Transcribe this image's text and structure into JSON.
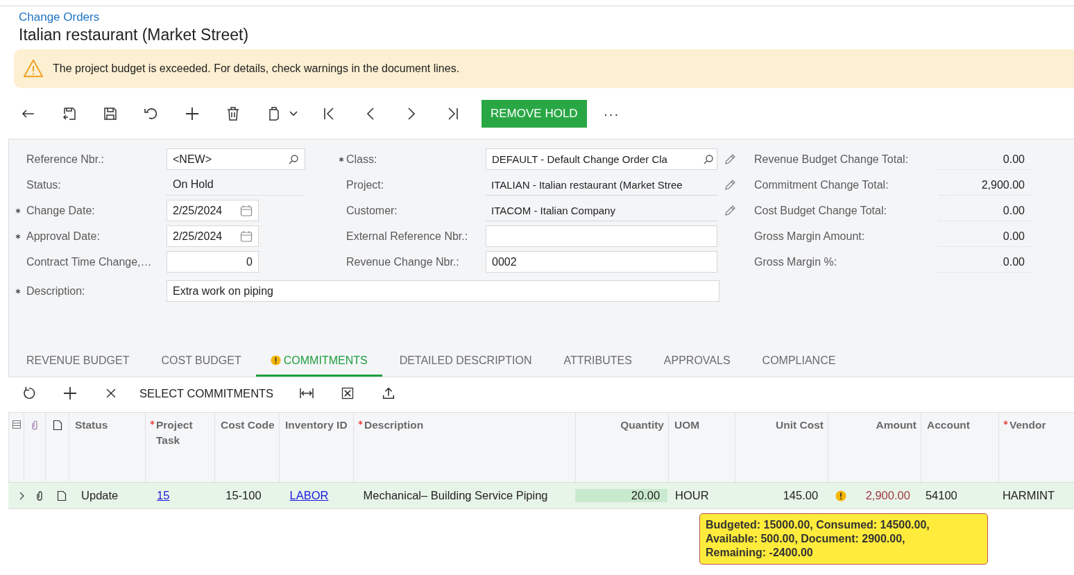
{
  "breadcrumb": "Change Orders",
  "title": "Italian restaurant (Market Street)",
  "banner": {
    "text": "The project budget is exceeded. For details, check warnings in the document lines."
  },
  "toolbar": {
    "primary": "REMOVE HOLD",
    "more": "···"
  },
  "form": {
    "left": [
      {
        "label": "Reference Nbr.:",
        "required": false,
        "kind": "lookup",
        "value": "<NEW>"
      },
      {
        "label": "Status:",
        "required": false,
        "kind": "readonly",
        "value": "On Hold"
      },
      {
        "label": "Change Date:",
        "required": true,
        "kind": "date",
        "value": "2/25/2024"
      },
      {
        "label": "Approval Date:",
        "required": true,
        "kind": "date",
        "value": "2/25/2024"
      },
      {
        "label": "Contract Time Change,…",
        "required": false,
        "kind": "number",
        "value": "0"
      }
    ],
    "middle": [
      {
        "label": "Class:",
        "required": true,
        "kind": "lookup",
        "value": "DEFAULT - Default Change Order Cla"
      },
      {
        "label": "Project:",
        "required": false,
        "kind": "selector",
        "value": "ITALIAN - Italian restaurant (Market Stree"
      },
      {
        "label": "Customer:",
        "required": false,
        "kind": "selector",
        "value": "ITACOM - Italian Company"
      },
      {
        "label": "External Reference Nbr.:",
        "required": false,
        "kind": "text"
      },
      {
        "label": "Revenue Change Nbr.:",
        "required": false,
        "kind": "text",
        "value": "0002"
      }
    ],
    "description": {
      "label": "Description:",
      "required": true,
      "value": "Extra work on piping"
    },
    "totals": [
      {
        "label": "Revenue Budget Change Total:",
        "value": "0.00"
      },
      {
        "label": "Commitment Change Total:",
        "value": "2,900.00"
      },
      {
        "label": "Cost Budget Change Total:",
        "value": "0.00"
      },
      {
        "label": "Gross Margin Amount:",
        "value": "0.00"
      },
      {
        "label": "Gross Margin %:",
        "value": "0.00"
      }
    ]
  },
  "tabs": [
    {
      "label": "REVENUE BUDGET",
      "selected": false,
      "warning": false
    },
    {
      "label": "COST BUDGET",
      "selected": false,
      "warning": false
    },
    {
      "label": "COMMITMENTS",
      "selected": true,
      "warning": true
    },
    {
      "label": "DETAILED DESCRIPTION",
      "selected": false,
      "warning": false
    },
    {
      "label": "ATTRIBUTES",
      "selected": false,
      "warning": false
    },
    {
      "label": "APPROVALS",
      "selected": false,
      "warning": false
    },
    {
      "label": "COMPLIANCE",
      "selected": false,
      "warning": false
    }
  ],
  "grid_toolbar": {
    "action": "SELECT COMMITMENTS"
  },
  "table": {
    "columns": [
      {
        "label": "Status",
        "required": false
      },
      {
        "label": "Project Task",
        "required": true
      },
      {
        "label": "Cost Code",
        "required": false
      },
      {
        "label": "Inventory ID",
        "required": false
      },
      {
        "label": "Description",
        "required": true
      },
      {
        "label": "Quantity",
        "required": false
      },
      {
        "label": "UOM",
        "required": false
      },
      {
        "label": "Unit Cost",
        "required": false
      },
      {
        "label": "Amount",
        "required": false
      },
      {
        "label": "Account",
        "required": false
      },
      {
        "label": "Vendor",
        "required": true
      }
    ],
    "rows": [
      {
        "selected": true,
        "expanded": false,
        "cells": [
          {
            "text": "Update",
            "kind": "plain"
          },
          {
            "text": "15",
            "kind": "link"
          },
          {
            "text": "15-100",
            "kind": "plain"
          },
          {
            "text": "LABOR",
            "kind": "link"
          },
          {
            "text": "Mechanical– Building Service Piping",
            "kind": "plain"
          },
          {
            "text": "20.00",
            "kind": "active"
          },
          {
            "text": "HOUR",
            "kind": "plain"
          },
          {
            "text": "145.00",
            "kind": "plain"
          },
          {
            "text": "2,900.00",
            "kind": "warning"
          },
          {
            "text": "54100",
            "kind": "plain"
          },
          {
            "text": "HARMINT",
            "kind": "plain"
          }
        ]
      }
    ]
  },
  "tooltip": {
    "lines": [
      "Budgeted: 15000.00, Consumed: 14500.00,",
      "Available: 500.00, Document: 2900.00,",
      "Remaining: -2400.00"
    ]
  }
}
